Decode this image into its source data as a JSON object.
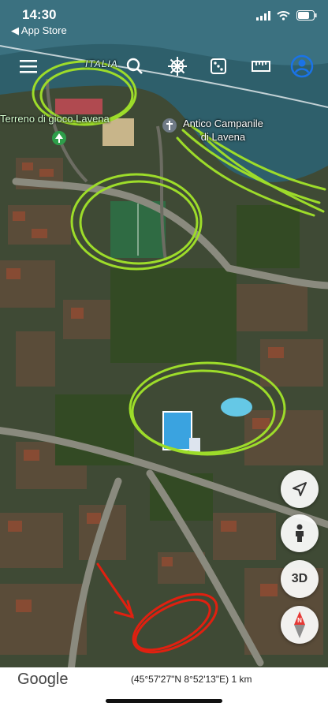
{
  "status": {
    "time": "14:30",
    "back_label": "◀ App Store"
  },
  "toolbar": {
    "items": [
      "menu-icon",
      "search-icon",
      "ships-wheel-icon",
      "dice-icon",
      "ruler-icon",
      "account-icon"
    ]
  },
  "map": {
    "country_label": "ITALIA",
    "places": [
      {
        "name": "Terreno di gioco Lavena",
        "type": "park"
      },
      {
        "name": "Antico Campanile\ndi Lavena",
        "type": "church"
      }
    ]
  },
  "controls": {
    "view_3d": "3D"
  },
  "footer": {
    "logo": "Google",
    "coordinates": "(45°57'27\"N 8°52'13\"E) 1 km"
  },
  "colors": {
    "annotation_green": "#9ddc2a",
    "annotation_red": "#e02010",
    "profile_blue": "#1a73e8",
    "compass_red": "#e53935"
  }
}
